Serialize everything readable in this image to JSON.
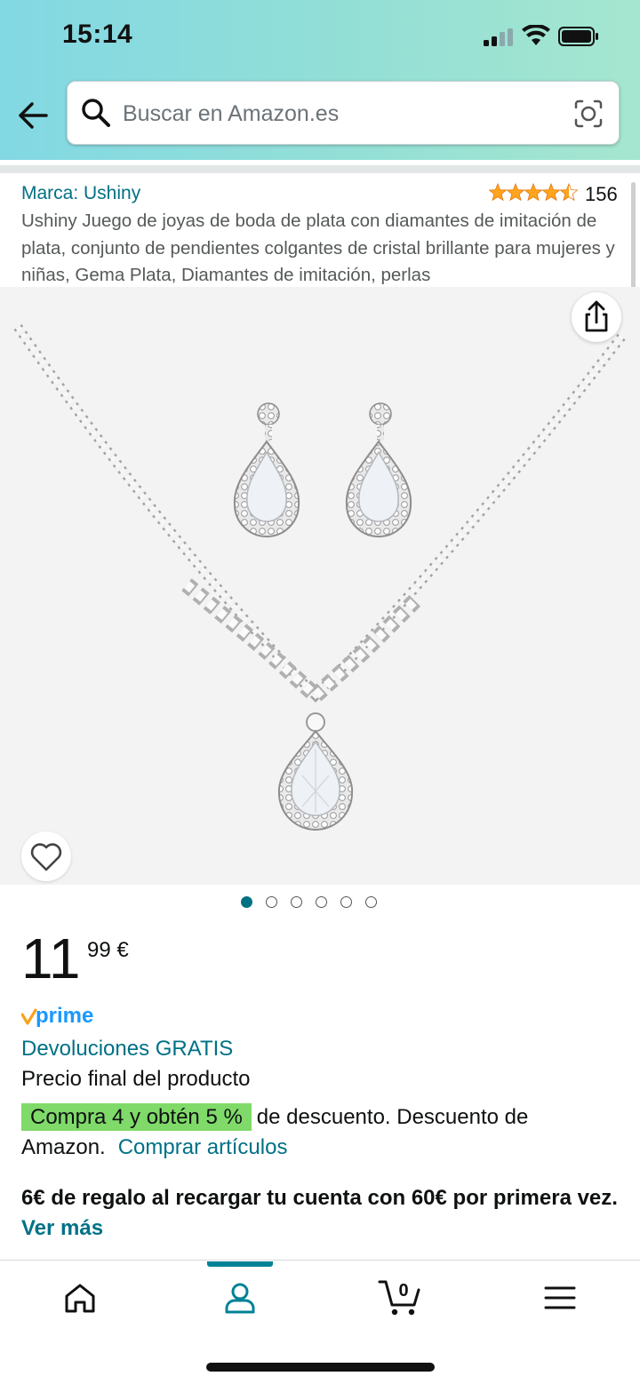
{
  "status_bar": {
    "time": "15:14"
  },
  "search": {
    "placeholder": "Buscar en Amazon.es"
  },
  "product": {
    "brand": "Marca: Ushiny",
    "rating_count": "156",
    "rating_stars": 4.5,
    "title": "Ushiny Juego de joyas de boda de plata con diamantes de imitación de plata, conjunto de pendientes colgantes de cristal brillante para mujeres y niñas, Gema Plata, Diamantes de imitación, perlas",
    "image_count": 6,
    "active_image": 1,
    "price_whole": "11",
    "price_fraction": "99 €",
    "prime_label": "prime",
    "returns": "Devoluciones GRATIS",
    "final_price_note": "Precio final del producto",
    "promo_tag": "Compra 4 y obtén 5 %",
    "promo_text": "de descuento. Descuento de Amazon.",
    "promo_link": "Comprar artículos",
    "gift_text": "6€ de regalo al recargar tu cuenta con 60€ por primera vez.",
    "gift_link": "Ver más"
  },
  "bottom_nav": {
    "items": [
      "home-icon",
      "account-icon",
      "cart-icon",
      "menu-icon"
    ],
    "active": "account-icon",
    "cart_count": "0"
  },
  "colors": {
    "link": "#007185",
    "promo_highlight": "#7fda69",
    "star": "#FFA41C",
    "nav_active": "#008296"
  }
}
